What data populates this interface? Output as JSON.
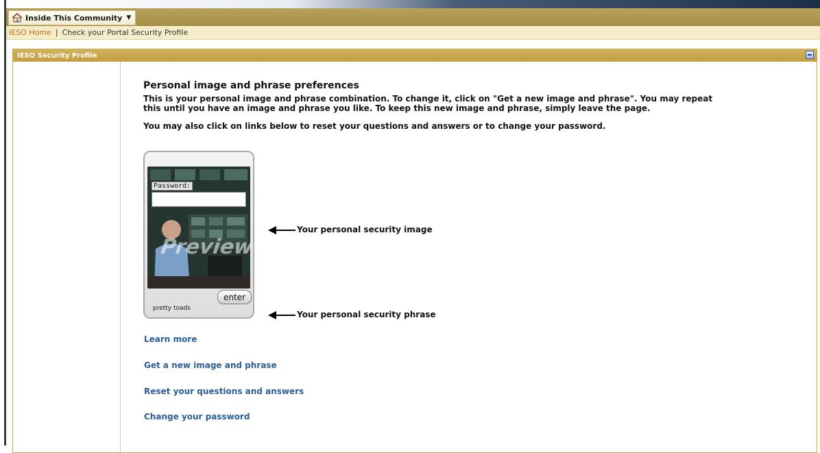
{
  "community": {
    "label": "Inside This Community",
    "icon": "home-icon"
  },
  "breadcrumb": {
    "home": "IESO Home",
    "separator": "|",
    "current": "Check your Portal Security Profile"
  },
  "panel": {
    "title": "IESO Security Profile"
  },
  "main": {
    "heading": "Personal image and phrase preferences",
    "description": "This is your personal image and phrase combination. To change it, click on \"Get a new image and phrase\". You may repeat this until you have an image and phrase you like. To keep this new image and phrase, simply leave the page.",
    "description2": "You may also click on links below to reset your questions and answers or to change your password."
  },
  "security_card": {
    "password_label": "Password:",
    "watermark": "Preview",
    "enter_label": "enter",
    "phrase": "pretty toads"
  },
  "callouts": {
    "image": "Your personal security image",
    "phrase": "Your personal security phrase"
  },
  "links": {
    "learn_more": "Learn more",
    "new_image": "Get a new image and phrase",
    "reset_questions": "Reset your questions and answers",
    "change_password": "Change your password"
  },
  "colors": {
    "gold": "#c39d3f",
    "link": "#2a5d9a",
    "breadcrumb_link": "#c56a1a"
  }
}
